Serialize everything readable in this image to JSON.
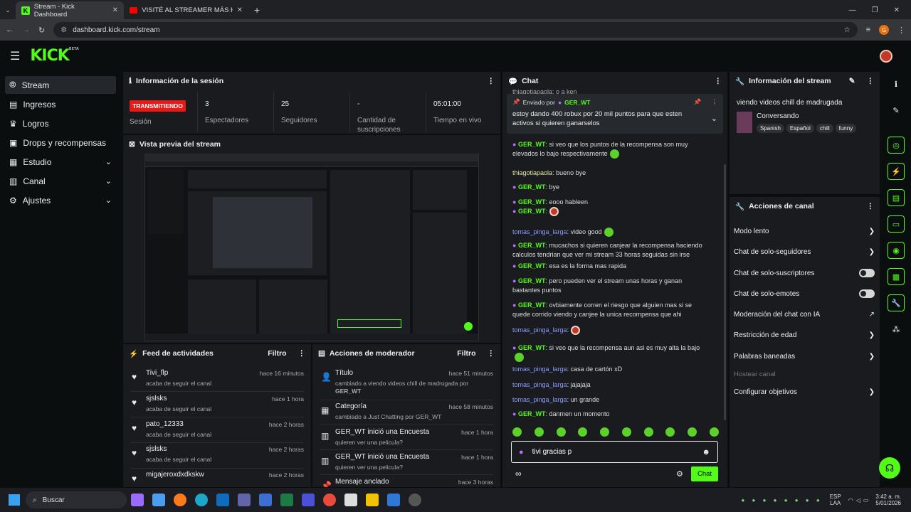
{
  "browser": {
    "tabs": [
      {
        "title": "Stream - Kick Dashboard",
        "icon": "kick-icon"
      },
      {
        "title": "VISITÉ AL STREAMER MÁS HUM",
        "icon": "youtube-icon"
      }
    ],
    "url": "dashboard.kick.com/stream",
    "profile_initial": "G"
  },
  "header": {
    "logo": "KICK",
    "logo_badge": "BETA"
  },
  "sidebar": {
    "items": [
      {
        "label": "Stream",
        "icon": "stream-icon",
        "active": true
      },
      {
        "label": "Ingresos",
        "icon": "money-icon"
      },
      {
        "label": "Logros",
        "icon": "trophy-icon"
      },
      {
        "label": "Drops y recompensas",
        "icon": "gift-icon"
      },
      {
        "label": "Estudio",
        "icon": "studio-icon",
        "chev": "⌄"
      },
      {
        "label": "Canal",
        "icon": "channel-icon",
        "chev": "⌄"
      },
      {
        "label": "Ajustes",
        "icon": "gear-icon",
        "chev": "⌄"
      }
    ]
  },
  "session": {
    "title": "Información de la sesión",
    "live_badge": "TRANSMITIENDO",
    "live_label": "Sesión",
    "stats": [
      {
        "value": "3",
        "label": "Espectadores"
      },
      {
        "value": "25",
        "label": "Seguidores"
      },
      {
        "value": "-",
        "label": "Cantidad de suscripciones"
      },
      {
        "value": "05:01:00",
        "label": "Tiempo en vivo"
      }
    ]
  },
  "preview": {
    "title": "Vista previa del stream"
  },
  "feed": {
    "title": "Feed de actividades",
    "filter": "Filtro",
    "items": [
      {
        "user": "Tivi_flp",
        "text": "acaba de seguir el canal",
        "time": "hace 16 minutos"
      },
      {
        "user": "sjslsks",
        "text": "acaba de seguir el canal",
        "time": "hace 1 hora"
      },
      {
        "user": "pato_12333",
        "text": "acaba de seguir el canal",
        "time": "hace 2 horas"
      },
      {
        "user": "sjslsks",
        "text": "acaba de seguir el canal",
        "time": "hace 2 horas"
      },
      {
        "user": "migajeroxdxdkskw",
        "text": "",
        "time": "hace 2 horas"
      }
    ]
  },
  "mod": {
    "title": "Acciones de moderador",
    "filter": "Filtro",
    "items": [
      {
        "title": "Título",
        "line1": "cambiado a viendo videos chill de madrugada por",
        "line2": "GER_WT",
        "time": "hace 51 minutos",
        "icon": "user-edit-icon"
      },
      {
        "title": "Categoría",
        "line1": "cambiado a Just Chatting por GER_WT",
        "line2": "",
        "time": "hace 58 minutos",
        "icon": "category-icon"
      },
      {
        "title": "GER_WT inició una Encuesta",
        "line1": "quieren ver una pelicula?",
        "line2": "",
        "time": "hace 1 hora",
        "icon": "poll-icon"
      },
      {
        "title": "GER_WT inició una Encuesta",
        "line1": "quieren ver una pelicula?",
        "line2": "",
        "time": "hace 1 hora",
        "icon": "poll-icon"
      },
      {
        "title": "Mensaje anclado",
        "line1": "",
        "line2": "",
        "time": "hace 3 horas",
        "icon": "pin-icon"
      }
    ]
  },
  "chat": {
    "title": "Chat",
    "cut_top": "thiagotiapaola: o a ken",
    "pinned_by_label": "Enviado por",
    "pinned_by_user": "GER_WT",
    "pinned_text": "estoy dando 400 robux por 20 mil puntos para que esten activos si quieren ganarselos",
    "messages": [
      {
        "user": "GER_WT",
        "text": ": si veo que los puntos de la recompensa son muy elevados lo bajo respectivamente",
        "kind": "mod"
      },
      {
        "user": "thiagotiapaola",
        "text": ": bueno bye",
        "kind": "yellow"
      },
      {
        "user": "GER_WT",
        "text": ": bye",
        "kind": "mod"
      },
      {
        "user": "GER_WT",
        "text": ": eooo hableen",
        "kind": "mod"
      },
      {
        "user": "GER_WT",
        "text": ":",
        "kind": "mod"
      },
      {
        "user": "tomas_pinga_larga",
        "text": ": video good",
        "kind": "blue"
      },
      {
        "user": "GER_WT",
        "text": ": mucachos si quieren canjear la recompensa haciendo calculos tendrian que ver mi stream 33 horas seguidas sin irse",
        "kind": "mod"
      },
      {
        "user": "GER_WT",
        "text": ": esa es la forma mas rapida",
        "kind": "mod"
      },
      {
        "user": "GER_WT",
        "text": ": pero pueden ver el stream unas horas y ganan bastantes puntos",
        "kind": "mod"
      },
      {
        "user": "GER_WT",
        "text": ": ovbiamente corren el riesgo que alguien mas si se quede corrido viendo y canjee la unica recompensa que ahi",
        "kind": "mod"
      },
      {
        "user": "tomas_pinga_larga",
        "text": ":",
        "kind": "blue"
      },
      {
        "user": "GER_WT",
        "text": ": si veo que la recompensa aun asi es muy alta la bajo",
        "kind": "mod"
      },
      {
        "user": "tomas_pinga_larga",
        "text": ": casa de cartón xD",
        "kind": "blue"
      },
      {
        "user": "tomas_pinga_larga",
        "text": ": jajajaja",
        "kind": "blue"
      },
      {
        "user": "tomas_pinga_larga",
        "text": ": un grande",
        "kind": "blue"
      },
      {
        "user": "GER_WT",
        "text": ": danmen un momento",
        "kind": "mod"
      }
    ],
    "input_value": "tivi gracias p",
    "send_label": "Chat"
  },
  "stream_info": {
    "title": "Información del stream",
    "stream_title": "viendo videos chill de madrugada",
    "category": "Conversando",
    "tags": [
      "Spanish",
      "Español",
      "chill",
      "funny"
    ]
  },
  "channel_actions": {
    "title": "Acciones de canal",
    "items": [
      {
        "label": "Modo lento",
        "control": "chevron"
      },
      {
        "label": "Chat de solo-seguidores",
        "control": "chevron"
      },
      {
        "label": "Chat de solo-suscriptores",
        "control": "toggle"
      },
      {
        "label": "Chat de solo-emotes",
        "control": "toggle"
      },
      {
        "label": "Moderación del chat con IA",
        "control": "external"
      },
      {
        "label": "Restricción de edad",
        "control": "chevron"
      },
      {
        "label": "Palabras baneadas",
        "control": "chevron"
      },
      {
        "label": "Hostear canal",
        "control": "none"
      },
      {
        "label": "Configurar objetivos",
        "control": "chevron"
      }
    ]
  },
  "taskbar": {
    "search": "Buscar",
    "lang1": "ESP",
    "lang2": "LAA",
    "time": "3:42 a. m.",
    "date": "5/01/2026"
  }
}
